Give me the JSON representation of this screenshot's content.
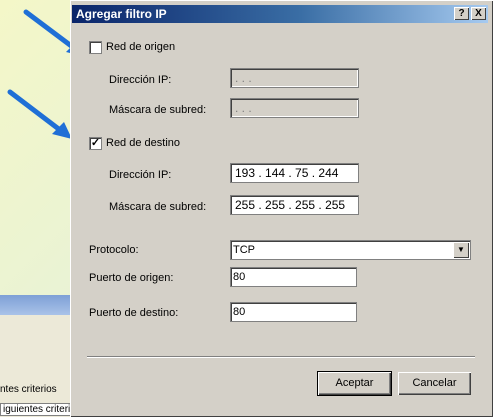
{
  "dialog": {
    "title": "Agregar filtro IP",
    "help_btn": "?",
    "close_btn": "X"
  },
  "source": {
    "checkbox_label": "Red de origen",
    "checked": false,
    "ip_label": "Dirección IP:",
    "mask_label": "Máscara de subred:",
    "ip_value": ".       .       .",
    "mask_value": ".       .       ."
  },
  "dest": {
    "checkbox_label": "Red de destino",
    "checked": true,
    "ip_label": "Dirección IP:",
    "mask_label": "Máscara de subred:",
    "ip_value": "193 . 144 .  75  . 244",
    "mask_value": "255 . 255 . 255 . 255"
  },
  "protocol": {
    "label": "Protocolo:",
    "value": "TCP"
  },
  "src_port": {
    "label": "Puerto de origen:",
    "value": "80"
  },
  "dst_port": {
    "label": "Puerto de destino:",
    "value": "80"
  },
  "buttons": {
    "ok": "Aceptar",
    "cancel": "Cancelar"
  },
  "background_window": {
    "line1": "ntes criterios",
    "line2": "iguientes criterios"
  },
  "colors": {
    "titlebar": "#0a246a",
    "dialog_bg": "#d4d0c8",
    "arrow": "#1f6fd6"
  }
}
